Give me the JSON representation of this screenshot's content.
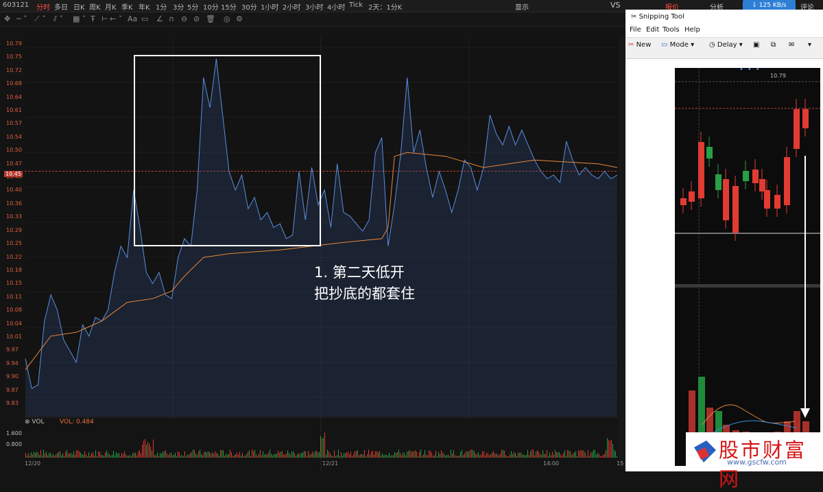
{
  "topbar": {
    "stock_code": "603121",
    "timeframes": [
      "分时",
      "多日",
      "日K",
      "周K",
      "月K",
      "季K",
      "年K",
      "1分",
      "3分",
      "5分",
      "10分",
      "15分",
      "30分",
      "1小时",
      "2小时",
      "3小时",
      "4小时",
      "Tick",
      "2天：1分K"
    ],
    "active_timeframe": "分时",
    "display_label": "显示",
    "vs_label": "VS",
    "quote_tab": "报价",
    "analysis_tab": "分析",
    "review_tab": "评论",
    "net_speed": "125 KB/s"
  },
  "toolbar": {
    "font_label": "Aa"
  },
  "chart": {
    "price_labels": [
      "10.79",
      "10.75",
      "10.72",
      "10.68",
      "10.64",
      "10.61",
      "10.57",
      "10.54",
      "10.50",
      "10.47",
      "10.43",
      "10.40",
      "10.36",
      "10.33",
      "10.29",
      "10.25",
      "10.22",
      "10.18",
      "10.15",
      "10.11",
      "10.08",
      "10.04",
      "10.01",
      "9.97",
      "9.94",
      "9.90",
      "9.87",
      "9.83"
    ],
    "ref_price": "10.45",
    "x_labels": [
      "12/20",
      "12/21",
      "14:00",
      "15"
    ],
    "annotation_line1": "1. 第二天低开",
    "annotation_line2": "把抄底的都套住",
    "colors": {
      "price_line": "#5a8fe0",
      "avg_line": "#e8893a",
      "ref_line": "#d9473a",
      "up": "#e23b32",
      "down": "#27a045"
    }
  },
  "volume": {
    "title": "VOL",
    "value_label": "VOL: 0.484",
    "labels": [
      "1.600",
      "0.800"
    ]
  },
  "chart_data": {
    "type": "line",
    "title": "",
    "xlabel": "",
    "ylabel": "",
    "ylim": [
      9.83,
      10.79
    ],
    "x": [
      "12/20",
      "12/21",
      "14:00"
    ],
    "series": [
      {
        "points": [
          [
            0,
            9.95
          ],
          [
            1,
            9.87
          ],
          [
            2,
            9.88
          ],
          [
            3,
            10.05
          ],
          [
            4,
            10.12
          ],
          [
            5,
            10.08
          ],
          [
            6,
            10.0
          ],
          [
            7,
            9.97
          ],
          [
            8,
            9.94
          ],
          [
            9,
            10.04
          ],
          [
            10,
            10.01
          ],
          [
            11,
            10.06
          ],
          [
            12,
            10.05
          ],
          [
            13,
            10.08
          ],
          [
            14,
            10.18
          ],
          [
            15,
            10.25
          ],
          [
            16,
            10.22
          ],
          [
            17,
            10.4
          ],
          [
            18,
            10.3
          ],
          [
            19,
            10.18
          ],
          [
            20,
            10.15
          ],
          [
            21,
            10.18
          ],
          [
            22,
            10.12
          ],
          [
            23,
            10.11
          ],
          [
            24,
            10.22
          ],
          [
            25,
            10.27
          ],
          [
            26,
            10.25
          ],
          [
            27,
            10.4
          ],
          [
            28,
            10.7
          ],
          [
            29,
            10.62
          ],
          [
            30,
            10.75
          ],
          [
            31,
            10.6
          ],
          [
            32,
            10.45
          ],
          [
            33,
            10.4
          ],
          [
            34,
            10.44
          ],
          [
            35,
            10.35
          ],
          [
            36,
            10.38
          ],
          [
            37,
            10.32
          ],
          [
            38,
            10.34
          ],
          [
            39,
            10.3
          ],
          [
            40,
            10.31
          ],
          [
            41,
            10.27
          ],
          [
            42,
            10.28
          ],
          [
            43,
            10.45
          ],
          [
            44,
            10.32
          ],
          [
            45,
            10.46
          ],
          [
            46,
            10.36
          ],
          [
            47,
            10.4
          ],
          [
            48,
            10.3
          ],
          [
            49,
            10.47
          ],
          [
            50,
            10.34
          ],
          [
            51,
            10.33
          ],
          [
            52,
            10.31
          ],
          [
            53,
            10.29
          ],
          [
            54,
            10.32
          ],
          [
            55,
            10.5
          ],
          [
            56,
            10.54
          ],
          [
            57,
            10.25
          ],
          [
            58,
            10.36
          ],
          [
            59,
            10.5
          ],
          [
            60,
            10.7
          ],
          [
            61,
            10.5
          ],
          [
            62,
            10.56
          ],
          [
            63,
            10.46
          ],
          [
            64,
            10.38
          ],
          [
            65,
            10.45
          ],
          [
            66,
            10.4
          ],
          [
            67,
            10.34
          ],
          [
            68,
            10.4
          ],
          [
            69,
            10.48
          ],
          [
            70,
            10.46
          ],
          [
            71,
            10.4
          ],
          [
            72,
            10.46
          ],
          [
            73,
            10.6
          ],
          [
            74,
            10.55
          ],
          [
            75,
            10.52
          ],
          [
            76,
            10.57
          ],
          [
            77,
            10.52
          ],
          [
            78,
            10.56
          ],
          [
            79,
            10.52
          ],
          [
            80,
            10.48
          ],
          [
            81,
            10.45
          ],
          [
            82,
            10.43
          ],
          [
            83,
            10.44
          ],
          [
            84,
            10.42
          ],
          [
            85,
            10.53
          ],
          [
            86,
            10.48
          ],
          [
            87,
            10.44
          ],
          [
            88,
            10.46
          ],
          [
            89,
            10.44
          ],
          [
            90,
            10.43
          ],
          [
            91,
            10.45
          ],
          [
            92,
            10.43
          ],
          [
            93,
            10.44
          ]
        ]
      },
      {
        "points": [
          [
            0,
            9.92
          ],
          [
            4,
            10.01
          ],
          [
            8,
            10.02
          ],
          [
            12,
            10.05
          ],
          [
            16,
            10.1
          ],
          [
            20,
            10.11
          ],
          [
            23,
            10.13
          ],
          [
            25,
            10.17
          ],
          [
            28,
            10.22
          ],
          [
            32,
            10.23
          ],
          [
            40,
            10.24
          ],
          [
            50,
            10.26
          ],
          [
            56,
            10.27
          ],
          [
            57,
            10.3
          ],
          [
            58,
            10.49
          ],
          [
            60,
            10.5
          ],
          [
            66,
            10.49
          ],
          [
            72,
            10.46
          ],
          [
            80,
            10.48
          ],
          [
            90,
            10.47
          ],
          [
            93,
            10.46
          ]
        ]
      }
    ]
  },
  "snipping_tool": {
    "title": "Snipping Tool",
    "menu": [
      "File",
      "Edit",
      "Tools",
      "Help"
    ],
    "buttons": {
      "new": "New",
      "mode": "Mode",
      "delay": "Delay"
    },
    "captured_price": "10.79"
  },
  "watermark": {
    "name": "股市财富网",
    "url": "www.gscfw.com"
  }
}
